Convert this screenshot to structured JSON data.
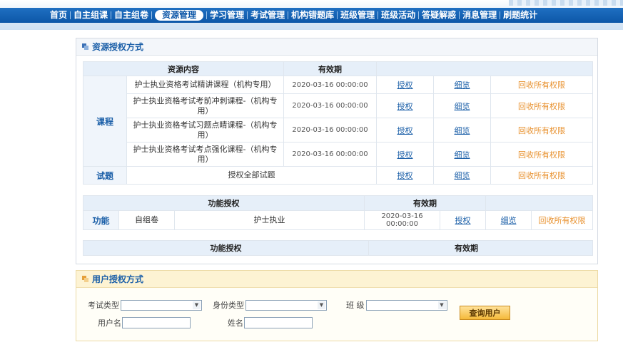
{
  "nav": {
    "items": [
      "首页",
      "自主组课",
      "自主组卷",
      "资源管理",
      "学习管理",
      "考试管理",
      "机构错题库",
      "班级管理",
      "班级活动",
      "答疑解惑",
      "消息管理",
      "刷题统计"
    ],
    "active_index": 3
  },
  "resource_panel": {
    "title": "资源授权方式",
    "table1": {
      "headers": {
        "content": "资源内容",
        "validity": "有效期"
      },
      "course_label": "课程",
      "rows": [
        {
          "name": "护士执业资格考试精讲课程（机构专用）",
          "date": "2020-03-16 00:00:00",
          "grant": "授权",
          "detail": "细览",
          "revoke": "回收所有权限"
        },
        {
          "name": "护士执业资格考试考前冲刺课程-（机构专用）",
          "date": "2020-03-16 00:00:00",
          "grant": "授权",
          "detail": "细览",
          "revoke": "回收所有权限"
        },
        {
          "name": "护士执业资格考试习题点睛课程-（机构专用）",
          "date": "2020-03-16 00:00:00",
          "grant": "授权",
          "detail": "细览",
          "revoke": "回收所有权限"
        },
        {
          "name": "护士执业资格考试考点强化课程-（机构专用）",
          "date": "2020-03-16 00:00:00",
          "grant": "授权",
          "detail": "细览",
          "revoke": "回收所有权限"
        }
      ],
      "exam_row": {
        "label": "试题",
        "name": "授权全部试题",
        "grant": "授权",
        "detail": "细览",
        "revoke": "回收所有权限"
      }
    },
    "table2": {
      "headers": {
        "function": "功能授权",
        "validity": "有效期"
      },
      "row": {
        "label": "功能",
        "type": "自组卷",
        "name": "护士执业",
        "date": "2020-03-16 00:00:00",
        "grant": "授权",
        "detail": "细览",
        "revoke": "回收所有权限"
      }
    },
    "table3": {
      "headers": {
        "function": "功能授权",
        "validity": "有效期"
      }
    }
  },
  "user_panel": {
    "title": "用户授权方式",
    "exam_type_label": "考试类型",
    "identity_type_label": "身份类型",
    "class_label": "班 级",
    "username_label": "用户名",
    "name_label": "姓名",
    "query_button": "查询用户"
  }
}
